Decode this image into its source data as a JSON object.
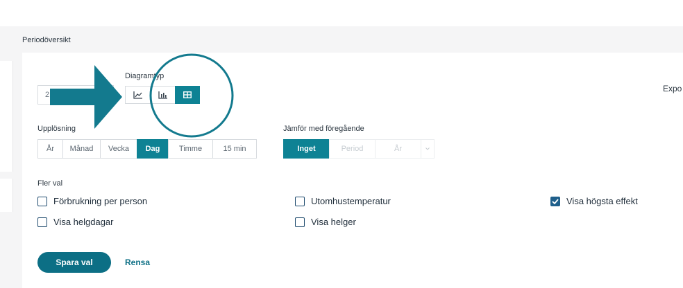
{
  "page": {
    "title": "Periodöversikt"
  },
  "date_input": {
    "value": "2"
  },
  "chart_type": {
    "label": "Diagramtyp",
    "buttons": [
      {
        "icon": "line-chart-icon",
        "active": false
      },
      {
        "icon": "bar-chart-icon",
        "active": false
      },
      {
        "icon": "table-icon",
        "active": true
      }
    ]
  },
  "export": {
    "label": "Expo"
  },
  "resolution": {
    "label": "Upplösning",
    "options": [
      "År",
      "Månad",
      "Vecka",
      "Dag",
      "Timme",
      "15 min"
    ],
    "selected": "Dag"
  },
  "compare": {
    "label": "Jämför med föregående",
    "options": [
      "Inget",
      "Period",
      "År"
    ],
    "selected": "Inget"
  },
  "more_options": {
    "label": "Fler val",
    "items": [
      {
        "label": "Förbrukning per person",
        "checked": false
      },
      {
        "label": "Visa helgdagar",
        "checked": false
      },
      {
        "label": "Utomhustemperatur",
        "checked": false
      },
      {
        "label": "Visa helger",
        "checked": false
      },
      {
        "label": "Visa högsta effekt",
        "checked": true
      }
    ]
  },
  "actions": {
    "save_label": "Spara val",
    "reset_label": "Rensa"
  },
  "colors": {
    "accent": "#0e8294",
    "annotation": "#137a8e",
    "checkbox": "#1f5f8b"
  }
}
